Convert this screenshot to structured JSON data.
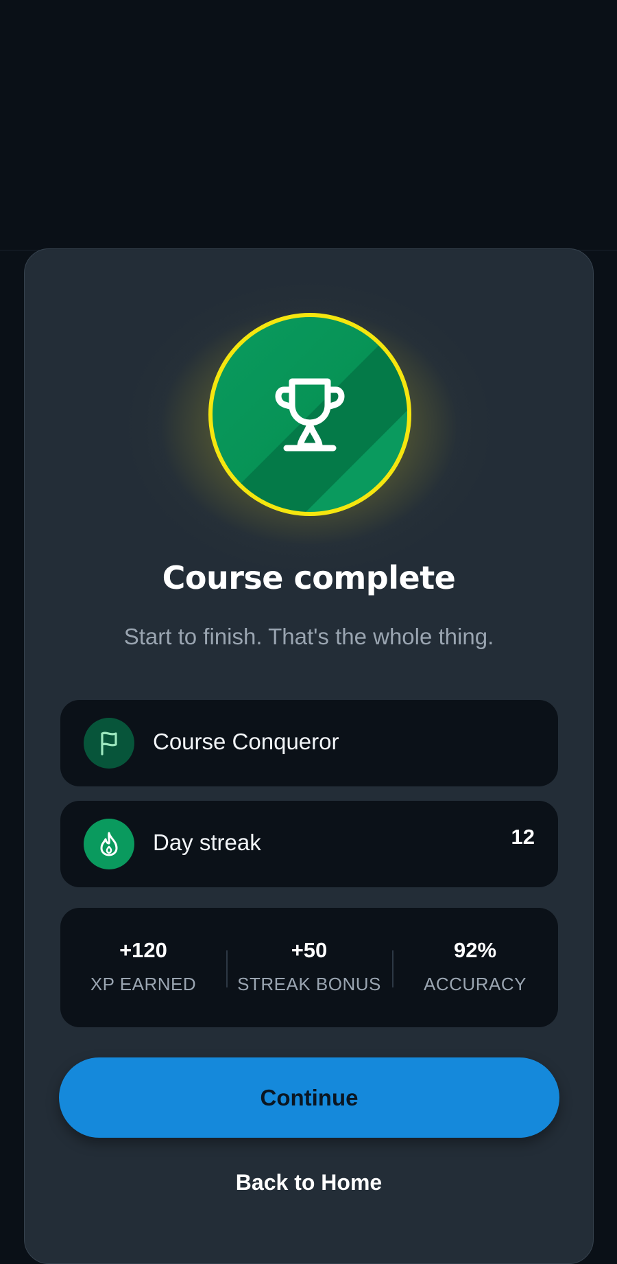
{
  "colors": {
    "background": "#0a1017",
    "sheet": "#232d37",
    "card": "#0b1118",
    "badge_green": "#0a9a5e",
    "badge_ring": "#f5e60f",
    "primary_button": "#1589db",
    "muted_text": "#9aa5b1"
  },
  "completion": {
    "badge_icon": "trophy-icon",
    "title": "Course complete",
    "subtitle": "Start to finish. That's the whole thing."
  },
  "achievements": [
    {
      "icon": "flag-icon",
      "label": "Course Conqueror",
      "value": ""
    },
    {
      "icon": "flame-icon",
      "label": "Day streak",
      "value": "12"
    }
  ],
  "stats": [
    {
      "value": "+120",
      "label": "XP EARNED"
    },
    {
      "value": "+50",
      "label": "STREAK BONUS"
    },
    {
      "value": "92%",
      "label": "ACCURACY"
    }
  ],
  "actions": {
    "continue_label": "Continue",
    "home_label": "Back to Home"
  }
}
